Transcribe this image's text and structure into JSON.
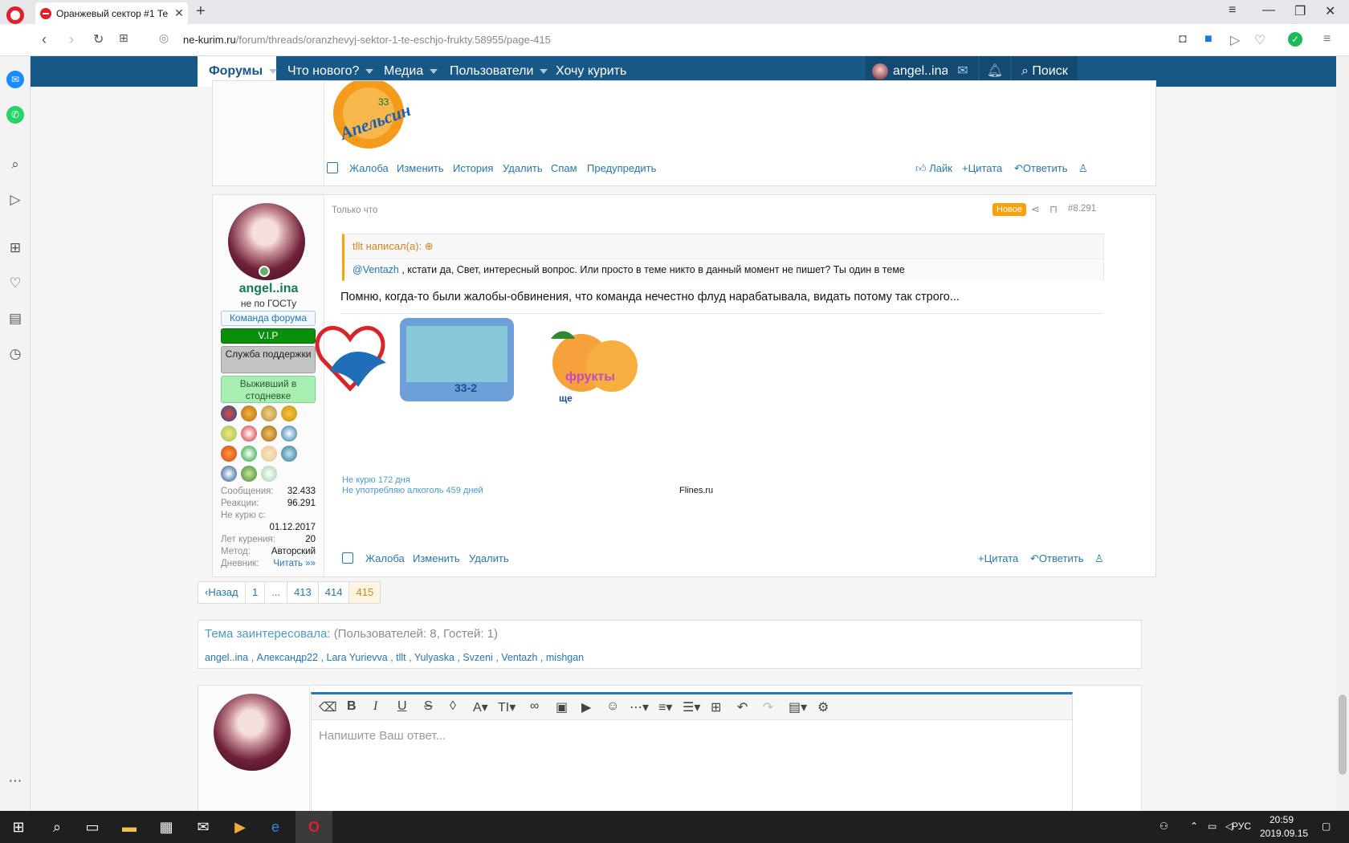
{
  "browser": {
    "tab_title": "Оранжевый сектор #1 Те",
    "url_host": "ne-kurim.ru",
    "url_path": "/forum/threads/oranzhevyj-sektor-1-te-eschjo-frukty.58955/page-415"
  },
  "nav": {
    "forums": "Форумы",
    "whats_new": "Что нового?",
    "media": "Медиа",
    "users": "Пользователи",
    "want_smoke": "Хочу курить",
    "username": "angel..ina",
    "search": "Поиск"
  },
  "prev_post": {
    "actions": [
      "Жалоба",
      "Изменить",
      "История",
      "Удалить",
      "Спам",
      "Предупредить"
    ],
    "like": "Лайк",
    "quote": "Цитата",
    "reply": "Ответить"
  },
  "post": {
    "time": "Только что",
    "badge": "Новое",
    "number": "#8.291",
    "quote_author": "tllt написал(а):",
    "quote_mention": "@Ventazh",
    "quote_text": " , кстати да, Свет, интересный вопрос. Или просто в теме никто в данный момент не пишет? Ты один в теме",
    "text": "Помню, когда-то были жалобы-обвинения, что команда нечестно флуд нарабатывала, видать потому так строго...",
    "sig_line1": "Не курю 172 дня",
    "sig_line2": "Не употребляю алкоголь 459 дней",
    "sig_site": "Flines.ru",
    "sig_badge3": "фрукты",
    "sig_badge3_sub": "ще",
    "sig_badge2_sub": "33-2",
    "actions": [
      "Жалоба",
      "Изменить",
      "Удалить"
    ],
    "quote_btn": "Цитата",
    "reply_btn": "Ответить"
  },
  "user": {
    "name": "angel..ina",
    "title": "не по ГОСТу",
    "banners": [
      "Команда форума",
      "V.I.P",
      "Служба поддержки",
      "Выживший в стодневке"
    ],
    "stats": [
      {
        "label": "Сообщения:",
        "value": "32.433"
      },
      {
        "label": "Реакции:",
        "value": "96.291"
      },
      {
        "label": "Не курю с:",
        "value": ""
      },
      {
        "label": "",
        "value": "01.12.2017"
      },
      {
        "label": "Лет курения:",
        "value": "20"
      },
      {
        "label": "Метод:",
        "value": "Авторский"
      },
      {
        "label": "Дневник:",
        "value": "Читать »»"
      }
    ]
  },
  "pagination": {
    "back": "Назад",
    "pages": [
      "1",
      "...",
      "413",
      "414",
      "415"
    ],
    "current": "415"
  },
  "interested": {
    "title": "Тема заинтересовала:",
    "counts": "(Пользователей: 8, Гостей: 1)",
    "users": [
      "angel..ina",
      "Александр22",
      "Lara Yurievva",
      "tllt",
      "Yulyaska",
      "Svzeni",
      "Ventazh",
      "mishgan"
    ]
  },
  "editor": {
    "placeholder": "Напишите Ваш ответ..."
  },
  "taskbar": {
    "lang": "РУС",
    "time": "20:59",
    "date": "2019.09.15"
  },
  "colors": {
    "nav_bg": "#185886",
    "link": "#2577b1",
    "username": "#127c4f",
    "new_badge": "#f9a10b"
  }
}
